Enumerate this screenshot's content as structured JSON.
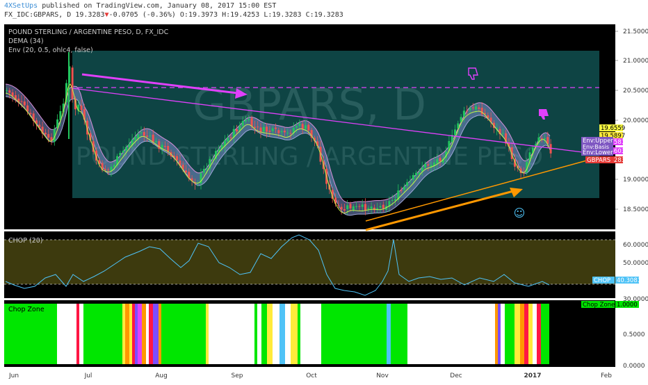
{
  "header": {
    "publisher": "4XSetUps",
    "published_text": " published on TradingView.com, January 08, 2017 15:00 EST",
    "symbol": "FX_IDC:GBPARS, D",
    "price": "19.3283",
    "change_arrow": "▼",
    "change": "-0.0705 (-0.36%)",
    "open": "O:19.3973",
    "high": "H:19.4253",
    "low": "L:19.3283",
    "close": "C:19.3283"
  },
  "main_pane": {
    "legend_title": "POUND STERLING / ARGENTINE PESO, D, FX_IDC",
    "legend_dema": "DEMA (34)",
    "legend_env": "Env (20, 0.5, ohlc4, false)",
    "watermark": "GBPARS, D",
    "watermark_sub": "POUND STERLING / ARGENTINE PESO",
    "price_axis": [
      "21.5000",
      "21.0000",
      "20.5000",
      "20.0000",
      "19.0000",
      "18.5000"
    ],
    "badges": [
      {
        "label": "19.6559",
        "color": "#f5f540",
        "text_color": "#000000"
      },
      {
        "label": "19.5897",
        "color": "#ffeb3b",
        "text_color": "#000000"
      },
      {
        "label": "19.5581",
        "color": "#e040fb",
        "text_color": "#ffffff"
      },
      {
        "label": "19.4603",
        "color": "#e040fb",
        "text_color": "#ffffff"
      },
      {
        "label": "19.3283",
        "color": "#e53935",
        "text_color": "#ffffff"
      }
    ],
    "overlay_labels": [
      {
        "label": "Env:Upper",
        "color": "#7e57c2"
      },
      {
        "label": "Env:Basis",
        "color": "#7e57c2"
      },
      {
        "label": "Env:Lower",
        "color": "#7e57c2"
      },
      {
        "label": "GBPARS",
        "color": "#e53935"
      }
    ],
    "emoji": "☺"
  },
  "chop_pane": {
    "legend": "CHOP (20)",
    "axis": [
      "60.0000",
      "50.0000",
      "30.0000"
    ],
    "value_label": "CHOP",
    "value": "40.3081"
  },
  "chopzone_pane": {
    "legend": "Chop Zone",
    "axis": [
      "0.5000",
      "0.0000"
    ],
    "value_label": "Chop Zone",
    "value": "1.0000"
  },
  "time_axis": [
    "Jun",
    "Jul",
    "Aug",
    "Sep",
    "Oct",
    "Nov",
    "Dec",
    "2017",
    "Feb"
  ],
  "colors": {
    "chart_bg": "#000000",
    "box_fill": "#0f4848",
    "candle_up": "#22c55e",
    "candle_down": "#ef5350",
    "trend_magenta": "#e040fb",
    "trend_orange": "#ff9800",
    "chop_fill": "#3d3a0e",
    "chop_line": "#4fc3f7"
  }
}
